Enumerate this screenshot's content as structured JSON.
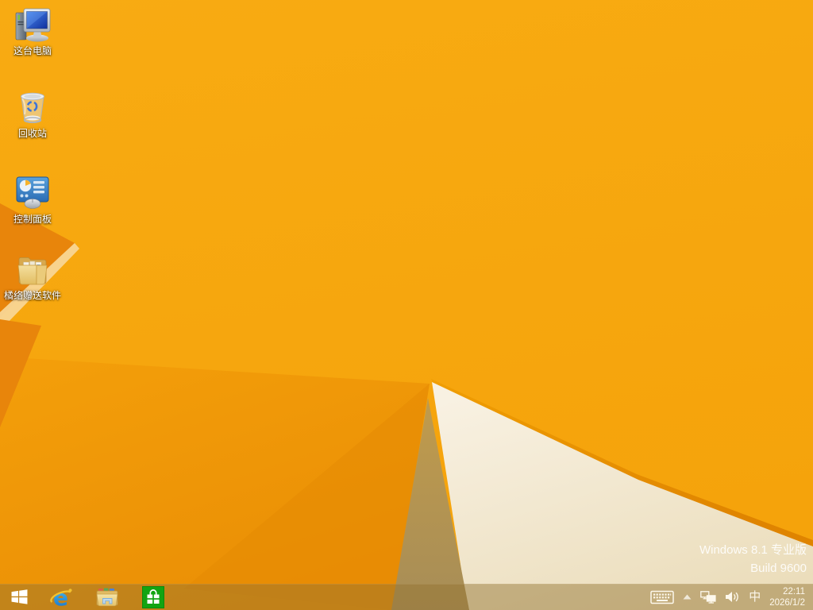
{
  "desktop": {
    "icons": [
      {
        "label": "这台电脑",
        "icon": "this-pc-icon"
      },
      {
        "label": "回收站",
        "icon": "recycle-bin-icon"
      },
      {
        "label": "控制面板",
        "icon": "control-panel-icon"
      },
      {
        "label": "橘络赠送软件",
        "icon": "shared-folder-icon"
      }
    ],
    "watermark": {
      "line1": "Windows 8.1 专业版",
      "line2": "Build 9600"
    }
  },
  "taskbar": {
    "apps": [
      {
        "name": "Internet Explorer",
        "icon": "ie-icon"
      },
      {
        "name": "File Explorer",
        "icon": "file-explorer-icon"
      },
      {
        "name": "Windows Store",
        "icon": "store-icon"
      }
    ],
    "tray": {
      "ime_indicator": "中",
      "clock": {
        "time": "22:11",
        "date": "2026/1/2"
      }
    }
  },
  "colors": {
    "wallpaper_amber": "#F7A80F",
    "wallpaper_dark_orange": "#E8850B",
    "wallpaper_cream": "#F3EAD3",
    "wallpaper_olive": "#B2924F",
    "taskbar_tint": "rgba(146,115,48,0.47)",
    "store_green": "#12A412",
    "ie_blue": "#2B9FE4"
  }
}
